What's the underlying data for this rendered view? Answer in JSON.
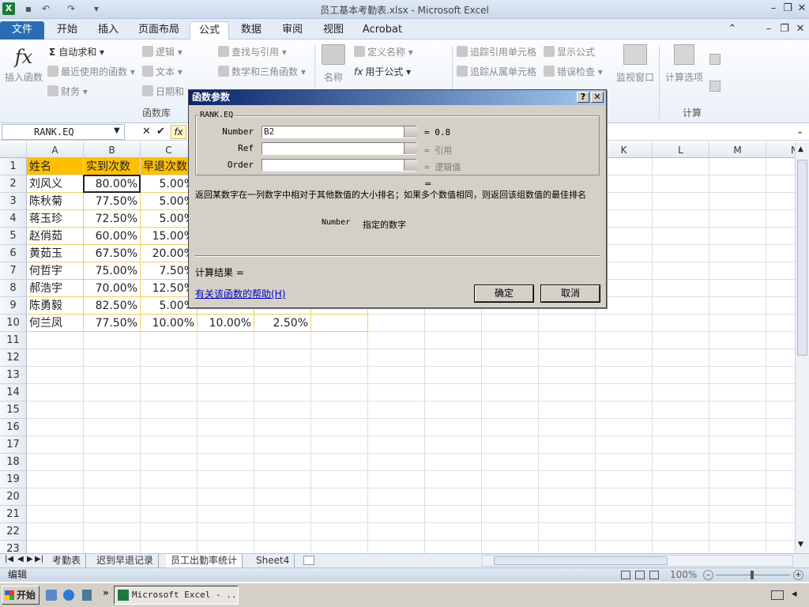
{
  "window": {
    "title": "员工基本考勤表.xlsx - Microsoft Excel",
    "min": "–",
    "restore": "❐",
    "close": "✕"
  },
  "ribbon_tabs": [
    "文件",
    "开始",
    "插入",
    "页面布局",
    "公式",
    "数据",
    "审阅",
    "视图",
    "Acrobat"
  ],
  "ribbon": {
    "insert_function": "插入函数",
    "autosum": "自动求和",
    "recent": "最近使用的函数",
    "finance": "财务",
    "logic": "逻辑",
    "text": "文本",
    "datetime": "日期和",
    "lookup": "查找与引用",
    "math": "数学和三角函数",
    "name": "名称",
    "define_name": "定义名称",
    "use_in_formula": "用于公式",
    "trace_prec": "追踪引用单元格",
    "trace_dep": "追踪从属单元格",
    "show_formula": "显示公式",
    "error_check": "错误检查",
    "watch": "监视窗口",
    "calc_options": "计算选项",
    "group_functions": "函数库",
    "group_calc": "计算"
  },
  "formula_bar": {
    "name_box": "RANK.EQ",
    "cancel": "✕",
    "enter": "✔",
    "fx": "fx"
  },
  "columns": [
    "A",
    "B",
    "C",
    "D",
    "E",
    "F",
    "G",
    "H",
    "I",
    "J",
    "K",
    "L",
    "M",
    "N"
  ],
  "rows": [
    "1",
    "2",
    "3",
    "4",
    "5",
    "6",
    "7",
    "8",
    "9",
    "10",
    "11",
    "12",
    "13",
    "14",
    "15",
    "16",
    "17",
    "18",
    "19",
    "20",
    "21",
    "22",
    "23"
  ],
  "sheet": {
    "headers": [
      "姓名",
      "实到次数",
      "早退次数"
    ],
    "data": [
      [
        "刘风义",
        "80.00%",
        "5.00%"
      ],
      [
        "陈秋菊",
        "77.50%",
        "5.00%"
      ],
      [
        "蒋玉珍",
        "72.50%",
        "5.00%"
      ],
      [
        "赵俏茹",
        "60.00%",
        "15.00%"
      ],
      [
        "黄茹玉",
        "67.50%",
        "20.00%"
      ],
      [
        "何哲宇",
        "75.00%",
        "7.50%"
      ],
      [
        "郝浩宇",
        "70.00%",
        "12.50%"
      ],
      [
        "陈勇毅",
        "82.50%",
        "5.00%"
      ],
      [
        "何兰凤",
        "77.50%",
        "10.00%",
        "10.00%",
        "2.50%"
      ]
    ]
  },
  "sheet_tabs": [
    "考勤表",
    "迟到早退记录",
    "员工出勤率统计",
    "Sheet4"
  ],
  "status": {
    "mode": "编辑",
    "zoom": "100%"
  },
  "taskbar": {
    "start": "开始",
    "task": "Microsoft Excel - ..."
  },
  "dialog": {
    "title": "函数参数",
    "help_btn": "?",
    "close_btn": "✕",
    "function_name": "RANK.EQ",
    "args": [
      {
        "label": "Number",
        "value": "B2",
        "result": "= 0.8"
      },
      {
        "label": "Ref",
        "value": "",
        "result": "= 引用"
      },
      {
        "label": "Order",
        "value": "",
        "result": "= 逻辑值"
      }
    ],
    "eq": "=",
    "description": "返回某数字在一列数字中相对于其他数值的大小排名；如果多个数值相同，则返回该组数值的最佳排名",
    "arg_help_name": "Number",
    "arg_help_text": "指定的数字",
    "calc_result": "计算结果 =",
    "help_link": "有关该函数的帮助(H)",
    "ok": "确定",
    "cancel": "取消"
  },
  "colors": {
    "file_tab": "#2a6db5",
    "header_fill": "#fdbf00",
    "dialog_title": "#0a246a"
  }
}
